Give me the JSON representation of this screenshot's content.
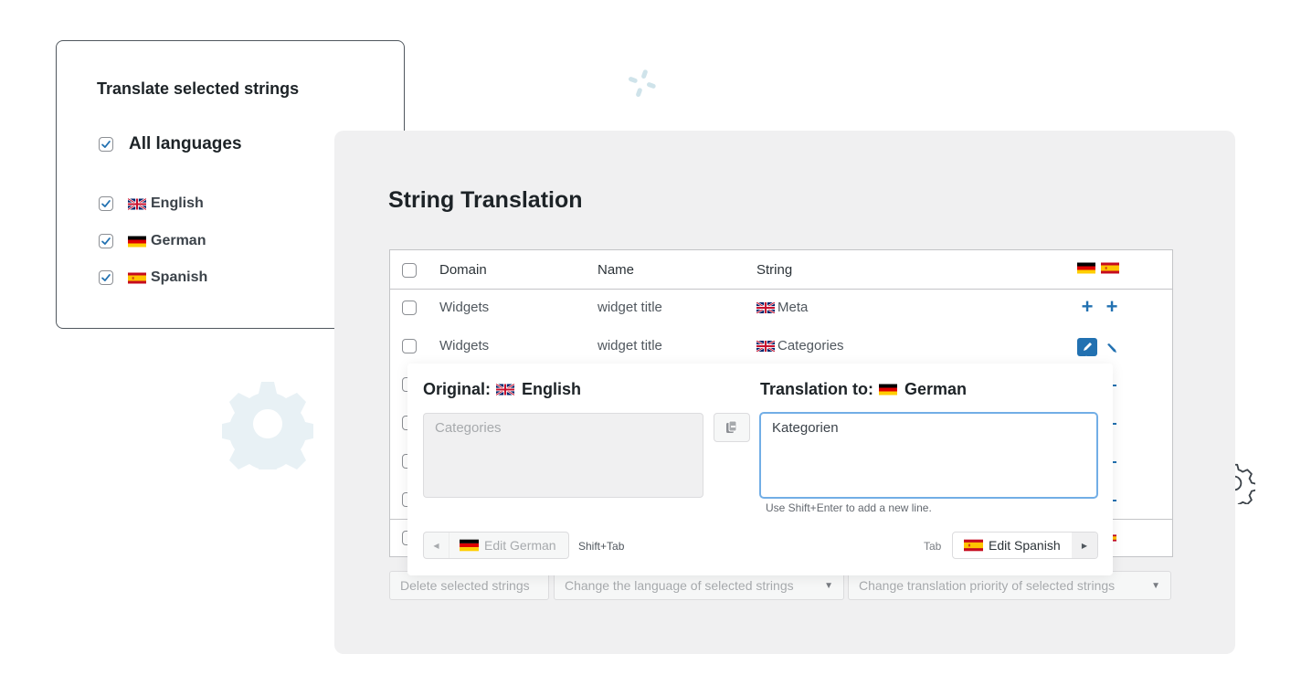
{
  "language_card": {
    "title": "Translate selected strings",
    "all_languages": {
      "label": "All languages",
      "checked": true
    },
    "languages": [
      {
        "label": "English",
        "flag": "gb-flag",
        "checked": true
      },
      {
        "label": "German",
        "flag": "de-flag",
        "checked": true
      },
      {
        "label": "Spanish",
        "flag": "es-flag",
        "checked": true
      }
    ]
  },
  "page": {
    "title": "String Translation"
  },
  "table": {
    "columns": {
      "domain": "Domain",
      "name": "Name",
      "string": "String",
      "languages": [
        "de-flag",
        "es-flag"
      ]
    },
    "rows": [
      {
        "domain": "Widgets",
        "name": "widget title",
        "string": "Meta",
        "string_flag": "gb-flag",
        "de_action": "add",
        "es_action": "add"
      },
      {
        "domain": "Widgets",
        "name": "widget title",
        "string": "Categories",
        "string_flag": "gb-flag",
        "de_action": "edit-active",
        "es_action": "edit"
      },
      {
        "domain": "",
        "name": "",
        "string": ""
      },
      {
        "domain": "",
        "name": "",
        "string": ""
      },
      {
        "domain": "",
        "name": "",
        "string": ""
      },
      {
        "domain": "",
        "name": "",
        "string": ""
      },
      {
        "domain": "",
        "name": "",
        "string": ""
      }
    ]
  },
  "bulk_actions": {
    "delete": "Delete selected strings",
    "change_language": "Change the language of selected strings",
    "change_priority": "Change translation priority of selected strings"
  },
  "popup": {
    "original_label": "Original:",
    "original_language": "English",
    "original_text": "Categories",
    "translation_label": "Translation to:",
    "translation_language": "German",
    "translation_text": "Kategorien",
    "hint": "Use Shift+Enter to add a new line.",
    "prev_button": "Edit German",
    "prev_shortcut": "Shift+Tab",
    "next_button": "Edit Spanish",
    "next_shortcut": "Tab"
  },
  "colors": {
    "accent": "#2271b1",
    "focus": "#72aee6",
    "panel_bg": "#f0f0f1"
  }
}
